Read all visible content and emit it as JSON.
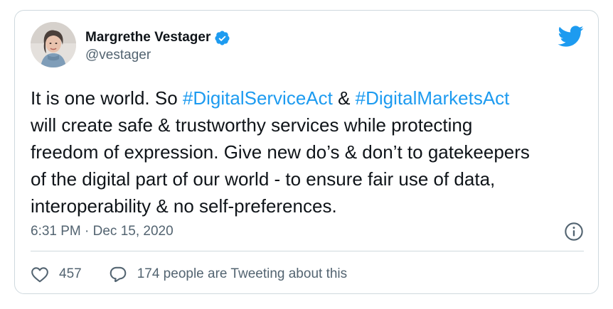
{
  "tweet": {
    "author": {
      "display_name": "Margrethe Vestager",
      "handle": "@vestager",
      "verified_icon": "verified-badge-icon",
      "avatar": "avatar-photo"
    },
    "text": {
      "line1_prefix": "It is one world. So ",
      "hashtag1": "#DigitalServiceAct",
      "line1_mid": " & ",
      "hashtag2": "#DigitalMarketsAct",
      "line2": "will create safe & trustworthy services while protecting",
      "line3": "freedom of expression. Give new do’s & don’t to gatekeepers",
      "line4": "of the digital part of our world - to ensure fair use of data,",
      "line5": "interoperability & no self-preferences."
    },
    "timestamp": "6:31 PM · Dec 15, 2020",
    "likes_count": "457",
    "reply_text": "174 people are Tweeting about this",
    "icons": {
      "brand": "twitter-bird-icon",
      "info": "info-icon",
      "like": "heart-icon",
      "reply": "speech-bubble-icon"
    },
    "colors": {
      "accent": "#1d9bf0",
      "text": "#0f1419",
      "muted": "#536471",
      "border": "#cfd9de"
    }
  }
}
